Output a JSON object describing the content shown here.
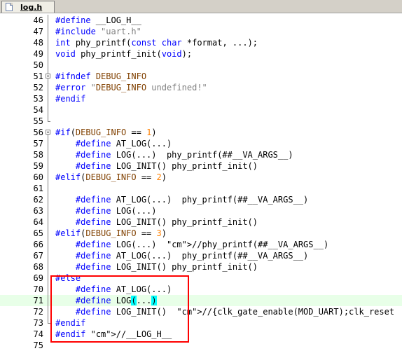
{
  "tab": {
    "title": "log.h"
  },
  "lines": [
    {
      "n": "46",
      "code": "#define __LOG_H__"
    },
    {
      "n": "47",
      "code": "#include \"uart.h\""
    },
    {
      "n": "48",
      "code": "int phy_printf(const char *format, ...);"
    },
    {
      "n": "49",
      "code": "void phy_printf_init(void);"
    },
    {
      "n": "50",
      "code": ""
    },
    {
      "n": "51",
      "code": "#ifndef DEBUG_INFO"
    },
    {
      "n": "52",
      "code": "#error \"DEBUG_INFO undefined!\""
    },
    {
      "n": "53",
      "code": "#endif"
    },
    {
      "n": "54",
      "code": ""
    },
    {
      "n": "55",
      "code": ""
    },
    {
      "n": "56",
      "code": "#if(DEBUG_INFO == 1)"
    },
    {
      "n": "57",
      "code": "    #define AT_LOG(...)"
    },
    {
      "n": "58",
      "code": "    #define LOG(...)  phy_printf(##__VA_ARGS__)"
    },
    {
      "n": "59",
      "code": "    #define LOG_INIT() phy_printf_init()"
    },
    {
      "n": "60",
      "code": "#elif(DEBUG_INFO == 2)"
    },
    {
      "n": "61",
      "code": ""
    },
    {
      "n": "62",
      "code": "    #define AT_LOG(...)  phy_printf(##__VA_ARGS__)"
    },
    {
      "n": "63",
      "code": "    #define LOG(...)"
    },
    {
      "n": "64",
      "code": "    #define LOG_INIT() phy_printf_init()"
    },
    {
      "n": "65",
      "code": "#elif(DEBUG_INFO == 3)"
    },
    {
      "n": "66",
      "code": "    #define LOG(...)  //phy_printf(##__VA_ARGS__)"
    },
    {
      "n": "67",
      "code": "    #define AT_LOG(...)  phy_printf(##__VA_ARGS__)"
    },
    {
      "n": "68",
      "code": "    #define LOG_INIT() phy_printf_init()"
    },
    {
      "n": "69",
      "code": "#else"
    },
    {
      "n": "70",
      "code": "    #define AT_LOG(...)"
    },
    {
      "n": "71",
      "code": "    #define LOG(...)"
    },
    {
      "n": "72",
      "code": "    #define LOG_INIT()  //{clk_gate_enable(MOD_UART);clk_reset"
    },
    {
      "n": "73",
      "code": "#endif"
    },
    {
      "n": "74",
      "code": "#endif //__LOG_H__"
    },
    {
      "n": "75",
      "code": ""
    }
  ]
}
